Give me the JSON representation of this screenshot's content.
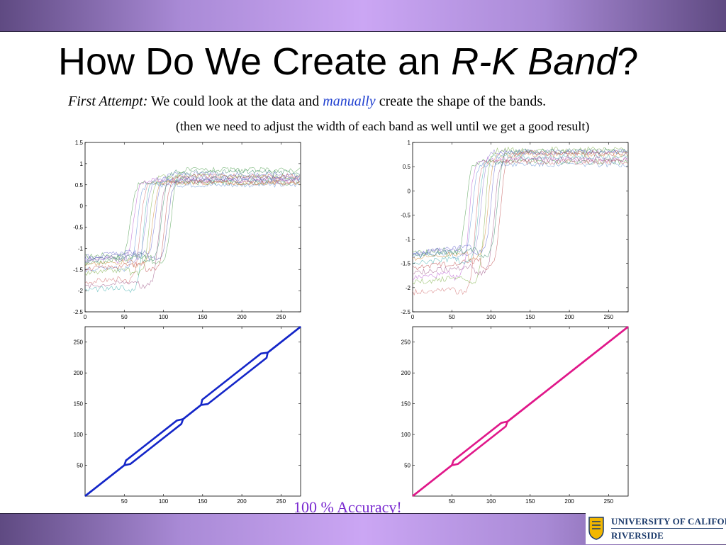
{
  "slide": {
    "title_main": "How Do We Create an ",
    "title_emph": "R-K Band",
    "title_end": "?",
    "subtitle_lead": "First Attempt:",
    "subtitle_a": " We could look at the data and ",
    "subtitle_hl": "manually",
    "subtitle_b": " create the shape of the bands.",
    "note": "(then we need to adjust the width of each band as well until we get a good result)",
    "accuracy": "100 % Accuracy!",
    "logo_line1": "UNIVERSITY OF CALIFORNIA",
    "logo_line2": "RIVERSIDE"
  },
  "colors": {
    "band_blue": "#1426c8",
    "band_pink": "#e0188a",
    "accuracy_text": "#7a2ad0",
    "highlight_text": "#1f3fd0",
    "logo_navy": "#1b3a6b",
    "logo_gold": "#f2b700"
  },
  "chart_data": [
    {
      "type": "line",
      "xlim": [
        0,
        275
      ],
      "ylim": [
        -2.5,
        1.5
      ],
      "xticks": [
        "0",
        "50",
        "100",
        "150",
        "200",
        "250"
      ],
      "yticks": [
        "1.5",
        "1",
        "0.5",
        "0",
        "-0.5",
        "-1",
        "-1.5",
        "-2",
        "-2.5"
      ],
      "series": [
        {
          "start": -1.2,
          "end": 0.55,
          "t": 58
        },
        {
          "start": -1.3,
          "end": 0.6,
          "t": 62
        },
        {
          "start": -1.5,
          "end": 0.5,
          "t": 66
        },
        {
          "start": -1.8,
          "end": 0.55,
          "t": 70
        },
        {
          "start": -2.0,
          "end": 0.6,
          "t": 74
        },
        {
          "start": -1.3,
          "end": 0.65,
          "t": 78
        },
        {
          "start": -1.6,
          "end": 0.7,
          "t": 82
        },
        {
          "start": -1.4,
          "end": 0.55,
          "t": 86
        },
        {
          "start": -1.2,
          "end": 0.75,
          "t": 90
        },
        {
          "start": -1.9,
          "end": 0.6,
          "t": 94
        },
        {
          "start": -1.3,
          "end": 0.8,
          "t": 98
        },
        {
          "start": -1.5,
          "end": 0.7,
          "t": 102
        },
        {
          "start": -1.25,
          "end": 0.65,
          "t": 106
        },
        {
          "start": -1.35,
          "end": 0.85,
          "t": 110
        }
      ]
    },
    {
      "type": "line",
      "xlim": [
        0,
        275
      ],
      "ylim": [
        -2.5,
        1
      ],
      "xticks": [
        "0",
        "50",
        "100",
        "150",
        "200",
        "250"
      ],
      "yticks": [
        "1",
        "0.5",
        "0",
        "-0.5",
        "-1",
        "-1.5",
        "-2",
        "-2.5"
      ],
      "series": [
        {
          "start": -1.3,
          "end": 0.6,
          "t": 68
        },
        {
          "start": -1.8,
          "end": 0.65,
          "t": 72
        },
        {
          "start": -1.35,
          "end": 0.55,
          "t": 76
        },
        {
          "start": -2.1,
          "end": 0.6,
          "t": 80
        },
        {
          "start": -1.5,
          "end": 0.7,
          "t": 84
        },
        {
          "start": -1.3,
          "end": 0.8,
          "t": 88
        },
        {
          "start": -1.9,
          "end": 0.85,
          "t": 92
        },
        {
          "start": -1.4,
          "end": 0.75,
          "t": 96
        },
        {
          "start": -1.3,
          "end": 0.8,
          "t": 100
        },
        {
          "start": -1.7,
          "end": 0.65,
          "t": 104
        },
        {
          "start": -1.35,
          "end": 0.82,
          "t": 108
        },
        {
          "start": -1.6,
          "end": 0.78,
          "t": 112
        }
      ]
    },
    {
      "type": "line",
      "xlim": [
        0,
        275
      ],
      "ylim": [
        0,
        275
      ],
      "xticks": [
        "50",
        "100",
        "150",
        "200",
        "250"
      ],
      "yticks": [
        "250",
        "200",
        "150",
        "100",
        "50"
      ],
      "band_color": "blue",
      "band": [
        {
          "x": 0,
          "w": 0
        },
        {
          "x": 50,
          "w": 0
        },
        {
          "x": 55,
          "w": 4
        },
        {
          "x": 120,
          "w": 4
        },
        {
          "x": 125,
          "w": 0
        },
        {
          "x": 148,
          "w": 0
        },
        {
          "x": 153,
          "w": 5
        },
        {
          "x": 228,
          "w": 5
        },
        {
          "x": 233,
          "w": 0
        },
        {
          "x": 275,
          "w": 0
        }
      ]
    },
    {
      "type": "line",
      "xlim": [
        0,
        275
      ],
      "ylim": [
        0,
        275
      ],
      "xticks": [
        "50",
        "100",
        "150",
        "200",
        "250"
      ],
      "yticks": [
        "250",
        "200",
        "150",
        "100",
        "50"
      ],
      "band_color": "pink",
      "band": [
        {
          "x": 0,
          "w": 0
        },
        {
          "x": 50,
          "w": 0
        },
        {
          "x": 55,
          "w": 4
        },
        {
          "x": 116,
          "w": 4
        },
        {
          "x": 121,
          "w": 0
        },
        {
          "x": 275,
          "w": 0
        }
      ]
    }
  ]
}
